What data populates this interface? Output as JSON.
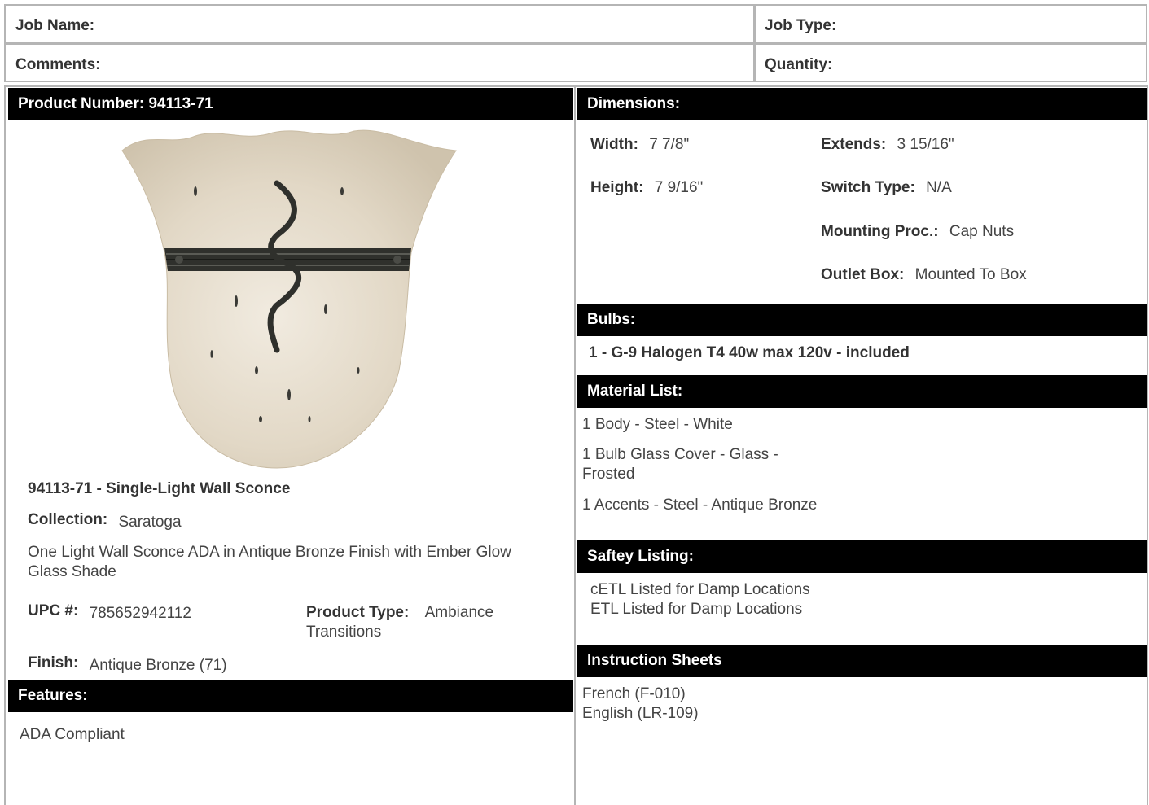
{
  "form": {
    "job_name_label": "Job Name:",
    "job_type_label": "Job Type:",
    "comments_label": "Comments:",
    "quantity_label": "Quantity:"
  },
  "product": {
    "header": "Product Number: 94113-71",
    "title": "94113-71 - Single-Light Wall Sconce",
    "collection_label": "Collection:",
    "collection_value": "Saratoga",
    "description": "One Light Wall Sconce ADA in Antique Bronze Finish with Ember Glow Glass Shade",
    "upc_label": "UPC #:",
    "upc_value": "785652942112",
    "product_type_label": "Product Type:",
    "product_type_value": "Ambiance Transitions",
    "finish_label": "Finish:",
    "finish_value": "Antique Bronze (71)"
  },
  "features": {
    "header": "Features:",
    "items": [
      "ADA Compliant"
    ]
  },
  "dimensions": {
    "header": "Dimensions:",
    "width_label": "Width:",
    "width_value": "7 7/8\"",
    "height_label": "Height:",
    "height_value": "7 9/16\"",
    "extends_label": "Extends:",
    "extends_value": "3 15/16\"",
    "switch_label": "Switch Type:",
    "switch_value": "N/A",
    "mounting_label": "Mounting Proc.:",
    "mounting_value": "Cap Nuts",
    "outlet_label": "Outlet Box:",
    "outlet_value": "Mounted To Box"
  },
  "bulbs": {
    "header": "Bulbs:",
    "text": "1 - G-9 Halogen T4 40w max 120v - included"
  },
  "materials": {
    "header": "Material List:",
    "items": [
      "1 Body - Steel - White",
      "1 Bulb Glass Cover - Glass - Frosted",
      "1 Accents - Steel - Antique Bronze"
    ]
  },
  "safety": {
    "header": "Saftey Listing:",
    "items": [
      "cETL Listed for Damp Locations",
      "ETL Listed for Damp Locations"
    ]
  },
  "instructions": {
    "header": "Instruction Sheets",
    "items": [
      "French (F-010)",
      "English (LR-109)"
    ]
  },
  "colors": {
    "header_bg": "#000000",
    "border": "#b5b5b5",
    "glass": "#e6dccb",
    "bronze": "#2f302c"
  },
  "icons": {
    "product_image": "wall-sconce-image"
  }
}
